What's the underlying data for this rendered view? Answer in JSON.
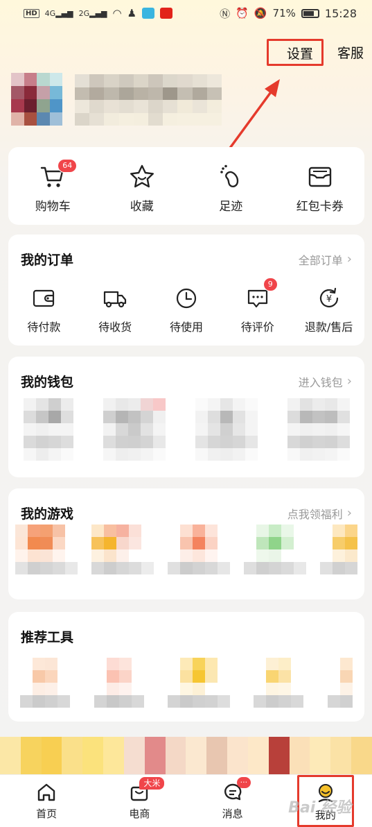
{
  "status_bar": {
    "left_tag": "HD",
    "sig1": "4G",
    "sig2": "2G",
    "battery": "71%",
    "time": "15:28"
  },
  "top_actions": {
    "settings": "设置",
    "service": "客服"
  },
  "quick_links": [
    {
      "label": "购物车",
      "icon": "cart-icon",
      "badge": "64"
    },
    {
      "label": "收藏",
      "icon": "star-icon"
    },
    {
      "label": "足迹",
      "icon": "footprint-icon"
    },
    {
      "label": "红包卡券",
      "icon": "coupon-icon"
    }
  ],
  "orders": {
    "title": "我的订单",
    "link": "全部订单",
    "items": [
      {
        "label": "待付款",
        "icon": "wallet-icon"
      },
      {
        "label": "待收货",
        "icon": "truck-icon"
      },
      {
        "label": "待使用",
        "icon": "clock-icon"
      },
      {
        "label": "待评价",
        "icon": "comment-icon",
        "badge": "9"
      },
      {
        "label": "退款/售后",
        "icon": "refund-icon"
      }
    ]
  },
  "wallet": {
    "title": "我的钱包",
    "link": "进入钱包"
  },
  "games": {
    "title": "我的游戏",
    "link": "点我领福利"
  },
  "tools": {
    "title": "推荐工具"
  },
  "tabbar": [
    {
      "label": "首页",
      "icon": "home-icon"
    },
    {
      "label": "电商",
      "icon": "shop-icon",
      "tag": "大米"
    },
    {
      "label": "消息",
      "icon": "message-icon",
      "tag": "···"
    },
    {
      "label": "我的",
      "icon": "profile-icon"
    }
  ],
  "watermark": "Bai 经验",
  "colors": {
    "accent_red": "#e53a2c",
    "badge_red": "#f0454a",
    "profile_yellow": "#f5c02a"
  }
}
